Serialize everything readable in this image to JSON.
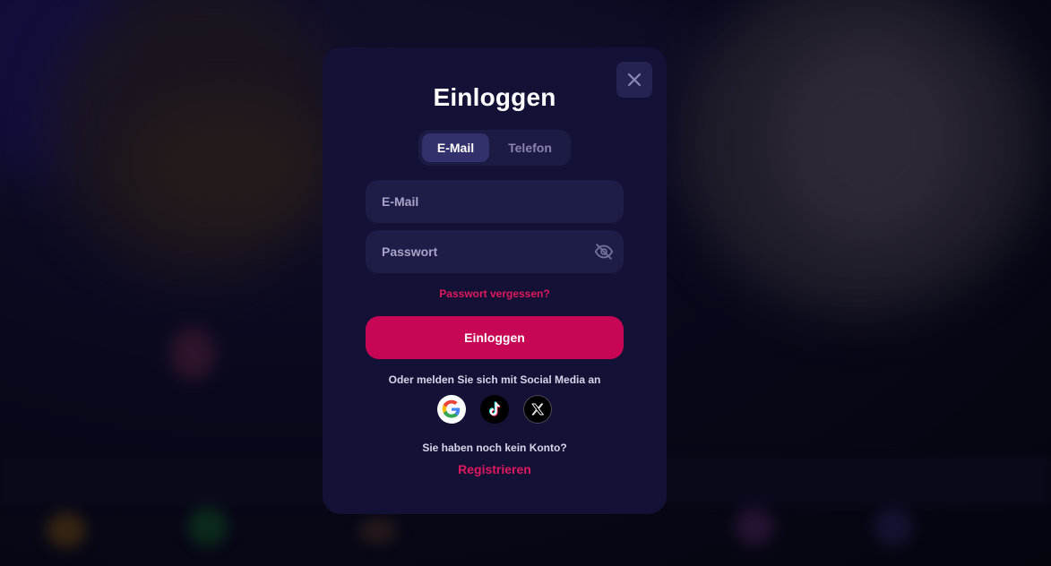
{
  "modal": {
    "title": "Einloggen",
    "tabs": [
      {
        "label": "E-Mail",
        "active": true
      },
      {
        "label": "Telefon",
        "active": false
      }
    ],
    "email_placeholder": "E-Mail",
    "password_placeholder": "Passwort",
    "forgot_password": "Passwort vergessen?",
    "login_button": "Einloggen",
    "social_prompt": "Oder melden Sie sich mit Social Media an",
    "social_icons": [
      "google-icon",
      "tiktok-icon",
      "x-icon"
    ],
    "no_account_text": "Sie haben noch kein Konto?",
    "register_link": "Registrieren",
    "close_icon": "close-icon",
    "password_toggle_icon": "eye-off-icon"
  },
  "colors": {
    "modal_bg": "#131236",
    "field_bg": "#1e1d47",
    "accent": "#c70655",
    "accent_text": "#e0185f",
    "active_tab": "#33316c"
  }
}
